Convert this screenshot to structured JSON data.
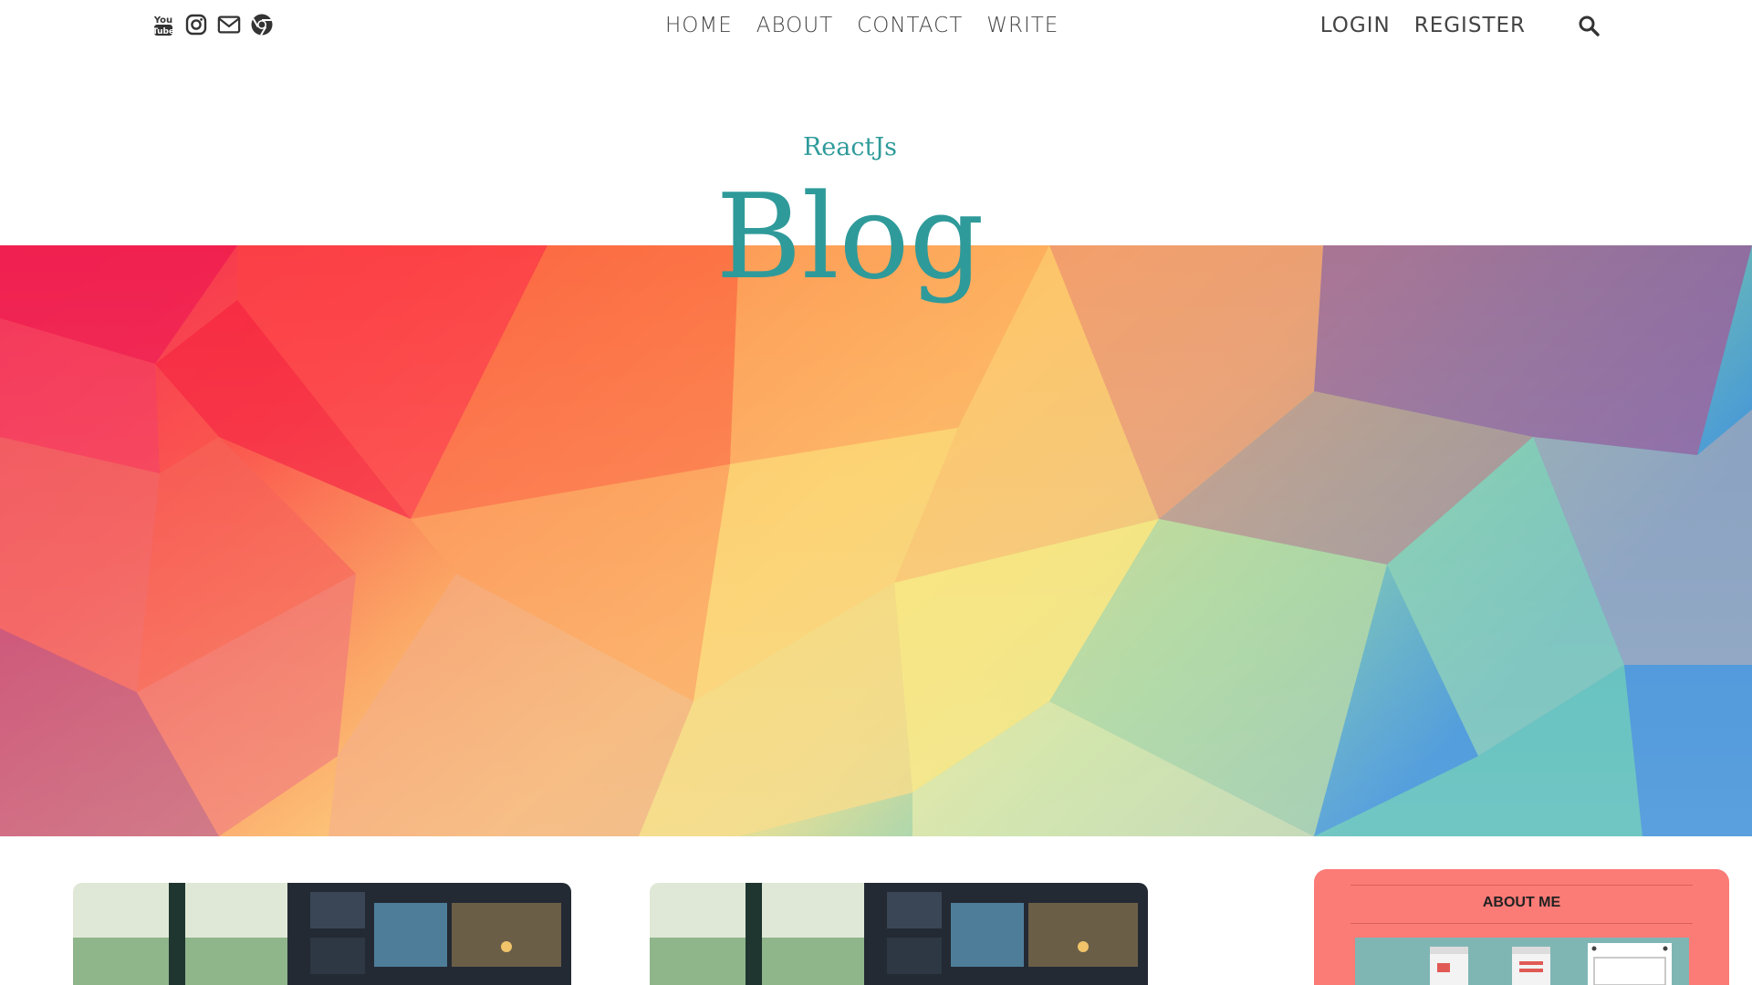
{
  "topbar": {
    "social": [
      {
        "name": "youtube",
        "icon": "youtube-icon"
      },
      {
        "name": "instagram",
        "icon": "instagram-icon"
      },
      {
        "name": "email",
        "icon": "envelope-icon"
      },
      {
        "name": "chrome",
        "icon": "chrome-icon"
      }
    ],
    "nav": [
      "HOME",
      "ABOUT",
      "CONTACT",
      "WRITE"
    ],
    "auth": [
      "LOGIN",
      "REGISTER"
    ],
    "search_icon": "search-icon"
  },
  "header": {
    "subtitle": "ReactJs",
    "title": "Blog",
    "accent_color": "#2f9a9a"
  },
  "sidebar": {
    "title": "ABOUT ME",
    "bg_color": "#fb7b77"
  }
}
